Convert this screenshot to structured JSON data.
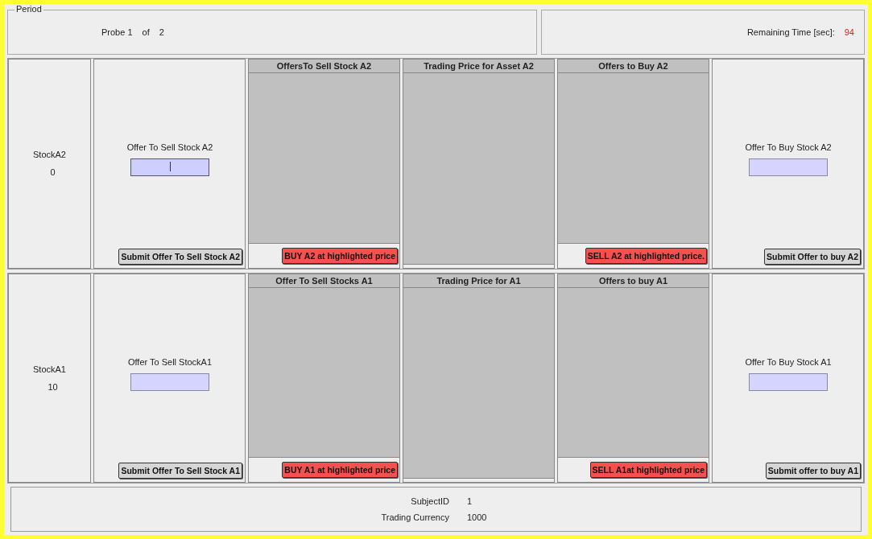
{
  "period": {
    "legend": "Period",
    "probe_label": "Probe 1",
    "of_label": "of",
    "total": "2"
  },
  "timer": {
    "label": "Remaining Time [sec]:",
    "value": "94"
  },
  "markets": [
    {
      "stock_label": "StockA2",
      "holdings": "0",
      "sell_label": "Offer To Sell Stock A2",
      "sell_field_focused": true,
      "sell_submit": "Submit Offer To Sell Stock A2",
      "asks_title": "OffersTo Sell Stock A2",
      "buy_at_price": "BUY A2 at highlighted price",
      "price_title": "Trading Price for Asset A2",
      "bids_title": "Offers to Buy A2",
      "sell_at_price": "SELL A2 at highlighted price.",
      "buy_label": "Offer To Buy Stock A2",
      "buy_field_focused": false,
      "buy_submit": "Submit Offer to buy A2"
    },
    {
      "stock_label": "StockA1",
      "holdings": "10",
      "sell_label": "Offer To Sell StockA1",
      "sell_field_focused": false,
      "sell_submit": "Submit Offer To Sell Stock A1",
      "asks_title": "Offer To Sell Stocks A1",
      "buy_at_price": "BUY A1 at highlighted price",
      "price_title": "Trading Price for A1",
      "bids_title": "Offers to buy A1",
      "sell_at_price": "SELL A1at highlighted price",
      "buy_label": "Offer To Buy Stock A1",
      "buy_field_focused": false,
      "buy_submit": "Submit offer to buy A1"
    }
  ],
  "footer": {
    "subject_label": "SubjectID",
    "subject_value": "1",
    "currency_label": "Trading Currency",
    "currency_value": "1000"
  }
}
